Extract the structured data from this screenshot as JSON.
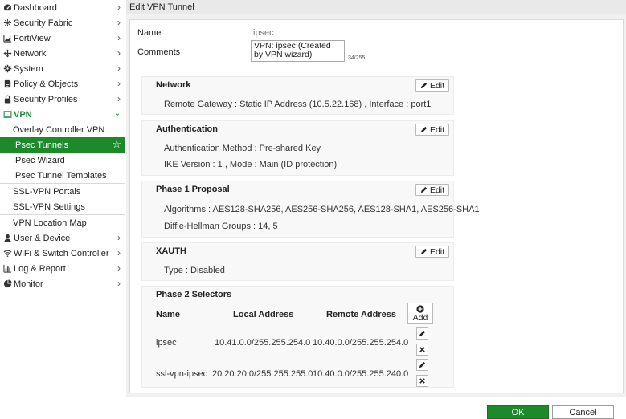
{
  "sidebar": {
    "items": [
      {
        "label": "Dashboard",
        "icon": "dashboard-icon"
      },
      {
        "label": "Security Fabric",
        "icon": "security-fabric-icon"
      },
      {
        "label": "FortiView",
        "icon": "fortiview-icon"
      },
      {
        "label": "Network",
        "icon": "network-icon"
      },
      {
        "label": "System",
        "icon": "gear-icon"
      },
      {
        "label": "Policy & Objects",
        "icon": "policy-icon"
      },
      {
        "label": "Security Profiles",
        "icon": "lock-icon"
      },
      {
        "label": "VPN",
        "icon": "monitor-icon"
      },
      {
        "label": "User & Device",
        "icon": "user-icon"
      },
      {
        "label": "WiFi & Switch Controller",
        "icon": "wifi-icon"
      },
      {
        "label": "Log & Report",
        "icon": "chart-icon"
      },
      {
        "label": "Monitor",
        "icon": "pie-icon"
      }
    ],
    "vpn_sub": [
      "Overlay Controller VPN",
      "IPsec Tunnels",
      "IPsec Wizard",
      "IPsec Tunnel Templates",
      "SSL-VPN Portals",
      "SSL-VPN Settings",
      "VPN Location Map"
    ],
    "accent_color": "#1d8a2a"
  },
  "header": {
    "title": "Edit VPN Tunnel"
  },
  "form": {
    "name_label": "Name",
    "name_value": "ipsec",
    "comments_label": "Comments",
    "comments_value": "VPN: ipsec (Created by VPN wizard)",
    "char_count": "34/255"
  },
  "sections": {
    "network": {
      "title": "Network",
      "edit_label": "Edit",
      "lines": [
        "Remote Gateway : Static IP Address (10.5.22.168) , Interface : port1"
      ]
    },
    "authentication": {
      "title": "Authentication",
      "edit_label": "Edit",
      "lines": [
        "Authentication Method : Pre-shared Key",
        "IKE Version : 1 , Mode : Main (ID protection)"
      ]
    },
    "phase1": {
      "title": "Phase 1 Proposal",
      "edit_label": "Edit",
      "lines": [
        "Algorithms : AES128-SHA256, AES256-SHA256, AES128-SHA1, AES256-SHA1",
        "Diffie-Hellman Groups : 14, 5"
      ]
    },
    "xauth": {
      "title": "XAUTH",
      "edit_label": "Edit",
      "lines": [
        "Type : Disabled"
      ]
    },
    "phase2": {
      "title": "Phase 2 Selectors",
      "add_label": "Add",
      "columns": [
        "Name",
        "Local Address",
        "Remote Address"
      ],
      "rows": [
        {
          "name": "ipsec",
          "local": "10.41.0.0/255.255.254.0",
          "remote": "10.40.0.0/255.255.254.0"
        },
        {
          "name": "ssl-vpn-ipsec",
          "local": "20.20.20.0/255.255.255.0",
          "remote": "10.40.0.0/255.255.240.0"
        }
      ]
    }
  },
  "footer": {
    "ok_label": "OK",
    "cancel_label": "Cancel"
  }
}
